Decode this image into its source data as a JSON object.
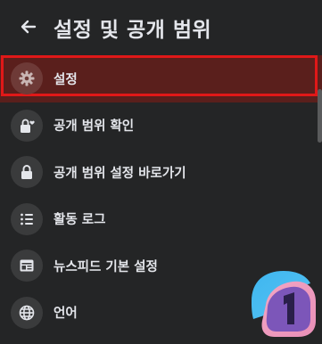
{
  "header": {
    "title": "설정 및 공개 범위",
    "back_icon": "arrow-left-icon"
  },
  "menu": {
    "items": [
      {
        "label": "설정",
        "icon": "gear-icon",
        "selected": true
      },
      {
        "label": "공개 범위 확인",
        "icon": "lock-heart-icon",
        "selected": false
      },
      {
        "label": "공개 범위 설정 바로가기",
        "icon": "lock-icon",
        "selected": false
      },
      {
        "label": "활동 로그",
        "icon": "list-icon",
        "selected": false
      },
      {
        "label": "뉴스피드 기본 설정",
        "icon": "newsfeed-icon",
        "selected": false
      },
      {
        "label": "언어",
        "icon": "globe-icon",
        "selected": false
      }
    ]
  },
  "colors": {
    "background": "#242526",
    "selected_bg": "#5a1f1c",
    "highlight_border": "#e01818",
    "text": "#e4e6eb",
    "icon_circle": "#3a3b3c"
  }
}
